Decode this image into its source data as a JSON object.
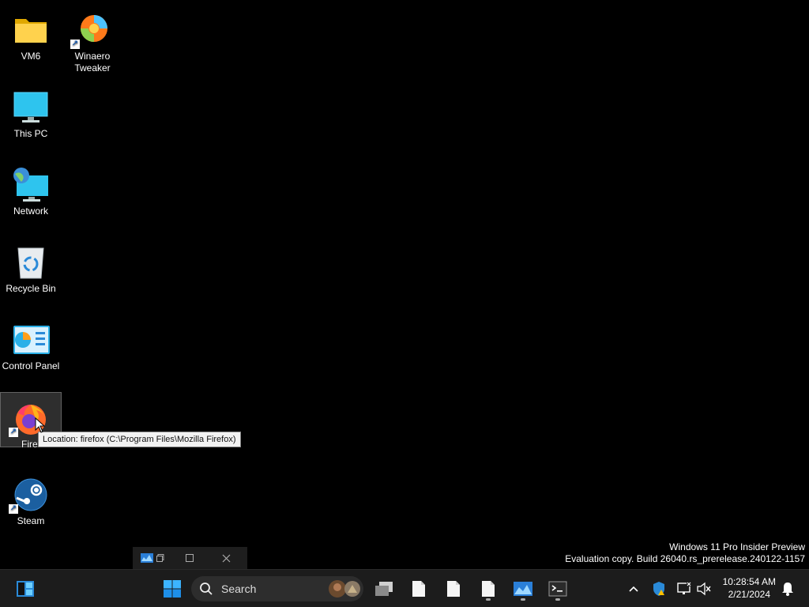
{
  "desktop": {
    "icons": [
      {
        "label": "VM6",
        "icon": "folder-icon"
      },
      {
        "label": "Winaero Tweaker",
        "icon": "winaero-tweaker-icon"
      },
      {
        "label": "This PC",
        "icon": "monitor-icon"
      },
      {
        "label": "Network",
        "icon": "network-icon"
      },
      {
        "label": "Recycle Bin",
        "icon": "recycle-bin-icon"
      },
      {
        "label": "Control Panel",
        "icon": "control-panel-icon"
      },
      {
        "label": "Firef",
        "icon": "firefox-icon"
      },
      {
        "label": "Steam",
        "icon": "steam-icon"
      }
    ],
    "tooltip": "Location: firefox (C:\\Program Files\\Mozilla Firefox)",
    "watermark_line1": "Windows 11 Pro Insider Preview",
    "watermark_line2": "Evaluation copy. Build 26040.rs_prerelease.240122-1157"
  },
  "taskbar": {
    "search_label": "Search",
    "clock_time": "10:28:54 AM",
    "clock_date": "2/21/2024",
    "accent_color": "#0078d4"
  }
}
